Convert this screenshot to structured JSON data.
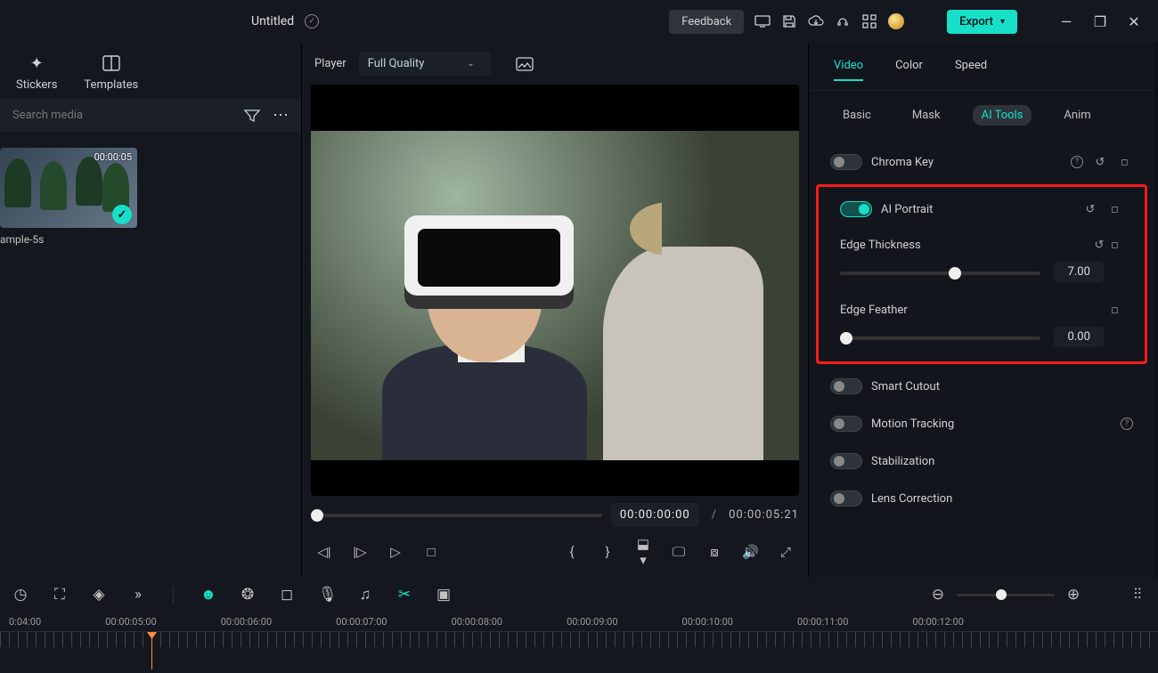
{
  "titlebar": {
    "project_name": "Untitled",
    "feedback_label": "Feedback",
    "export_label": "Export"
  },
  "library": {
    "tabs": {
      "stickers": "Stickers",
      "templates": "Templates"
    },
    "search_placeholder": "Search media",
    "clip": {
      "duration": "00:00:05",
      "name": "ample-5s"
    }
  },
  "player": {
    "label": "Player",
    "quality": "Full Quality",
    "current_time": "00:00:00:00",
    "duration": "00:00:05:21"
  },
  "properties": {
    "tabs": {
      "video": "Video",
      "color": "Color",
      "speed": "Speed"
    },
    "subtabs": {
      "basic": "Basic",
      "mask": "Mask",
      "ai_tools": "AI Tools",
      "anim": "Anim"
    },
    "chroma_key": {
      "label": "Chroma Key",
      "on": false
    },
    "ai_portrait": {
      "label": "AI Portrait",
      "on": true
    },
    "edge_thickness": {
      "label": "Edge Thickness",
      "value": "7.00",
      "pct": 54
    },
    "edge_feather": {
      "label": "Edge Feather",
      "value": "0.00",
      "pct": 0
    },
    "smart_cutout": {
      "label": "Smart Cutout",
      "on": false
    },
    "motion_tracking": {
      "label": "Motion Tracking",
      "on": false
    },
    "stabilization": {
      "label": "Stabilization",
      "on": false
    },
    "lens_correction": {
      "label": "Lens Correction",
      "on": false
    }
  },
  "timeline": {
    "ruler": [
      "0:04:00",
      "00:00:05:00",
      "00:00:06:00",
      "00:00:07:00",
      "00:00:08:00",
      "00:00:09:00",
      "00:00:10:00",
      "00:00:11:00",
      "00:00:12:00"
    ]
  }
}
